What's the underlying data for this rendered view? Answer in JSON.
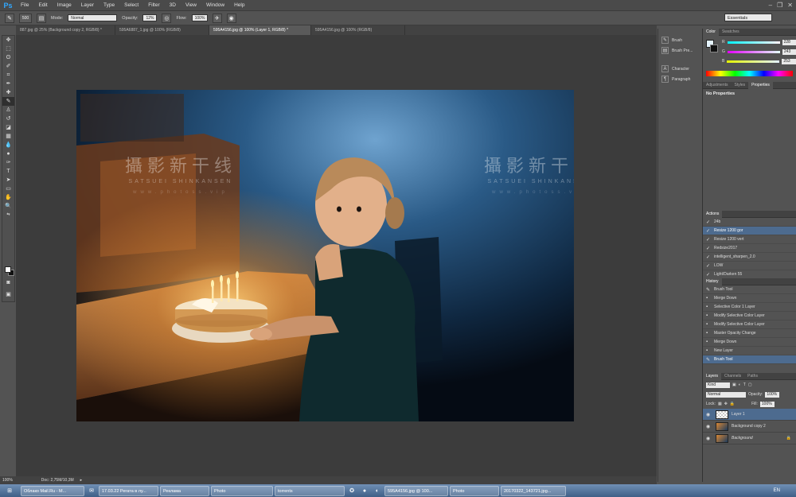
{
  "menubar": {
    "logo": "Ps",
    "items": [
      "File",
      "Edit",
      "Image",
      "Layer",
      "Type",
      "Select",
      "Filter",
      "3D",
      "View",
      "Window",
      "Help"
    ]
  },
  "options": {
    "brush_size": "500",
    "mode_label": "Mode:",
    "mode_value": "Normal",
    "opacity_label": "Opacity:",
    "opacity_value": "12%",
    "flow_label": "Flow:",
    "flow_value": "100%",
    "workspace": "Essentials"
  },
  "doc_tabs": [
    "887.jpg @ 25% (Background copy 2, RGB/8) *",
    "595A6887_1.jpg @ 100% (RGB/8)",
    "595A4156.jpg @ 100% (Layer 1, RGB/8) *",
    "595A4156.jpg @ 100% (RGB/8)"
  ],
  "watermark": {
    "cn": "攝影新干线",
    "en": "SATSUEI SHINKANSEN",
    "url": "www.photoss.vip"
  },
  "status": {
    "zoom": "100%",
    "doc": "Doc: 2,75M/10,3M"
  },
  "mini_panels": [
    {
      "icon": "brush-icon",
      "glyph": "✎",
      "label": "Brush"
    },
    {
      "icon": "brush-presets-icon",
      "glyph": "▤",
      "label": "Brush Pre..."
    },
    {
      "icon": "character-icon",
      "glyph": "A",
      "label": "Character"
    },
    {
      "icon": "paragraph-icon",
      "glyph": "¶",
      "label": "Paragraph"
    }
  ],
  "color_panel": {
    "tabs": [
      "Color",
      "Swatches"
    ],
    "rows": [
      {
        "label": "R",
        "value": "228"
      },
      {
        "label": "G",
        "value": "243"
      },
      {
        "label": "B",
        "value": "253"
      }
    ]
  },
  "properties_panel": {
    "tabs": [
      "Adjustments",
      "Styles",
      "Properties"
    ],
    "title": "No Properties"
  },
  "actions_panel": {
    "title": "Actions",
    "items": [
      "24b",
      "Resize 1200 gor",
      "Resize 1200 vert",
      "Redsize2017",
      "intelligent_sharpen_2.0",
      "LOW",
      "Light/Darken 55"
    ]
  },
  "history_panel": {
    "title": "History",
    "items": [
      "Brush Tool",
      "Merge Down",
      "Selective Color 1 Layer",
      "Modify Selective Color Layer",
      "Modify Selective Color Layer",
      "Master Opacity Change",
      "Merge Down",
      "New Layer",
      "Brush Tool"
    ]
  },
  "layers_panel": {
    "tabs": [
      "Layers",
      "Channels",
      "Paths"
    ],
    "kind_label": "Kind",
    "blend_mode": "Normal",
    "opacity_label": "Opacity:",
    "opacity_value": "100%",
    "lock_label": "Lock:",
    "fill_label": "Fill:",
    "fill_value": "100%",
    "layers": [
      "Layer 1",
      "Background copy 2",
      "Background"
    ]
  },
  "taskbar": {
    "items": [
      "Облако Mail.Ru - M...",
      "17.03.22 Регата в лу...",
      "Реклама",
      "Photo",
      "torrents",
      "595A4156.jpg @ 100...",
      "Photo",
      "20170322_143721.jpg..."
    ],
    "lang": "EN"
  },
  "colors": {
    "accent": "#31a8ff",
    "selection": "#4d6b8f"
  }
}
